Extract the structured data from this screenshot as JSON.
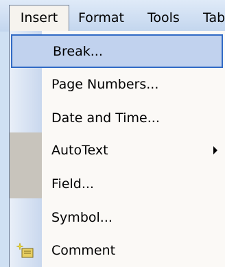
{
  "menubar": {
    "items": [
      {
        "label": "Insert"
      },
      {
        "label": "Format"
      },
      {
        "label": "Tools"
      },
      {
        "label": "Tab"
      }
    ]
  },
  "dropdown": {
    "items": [
      {
        "label": "Break..."
      },
      {
        "label": "Page Numbers..."
      },
      {
        "label": "Date and Time..."
      },
      {
        "label": "AutoText"
      },
      {
        "label": "Field..."
      },
      {
        "label": "Symbol..."
      },
      {
        "label": "Comment"
      }
    ]
  }
}
